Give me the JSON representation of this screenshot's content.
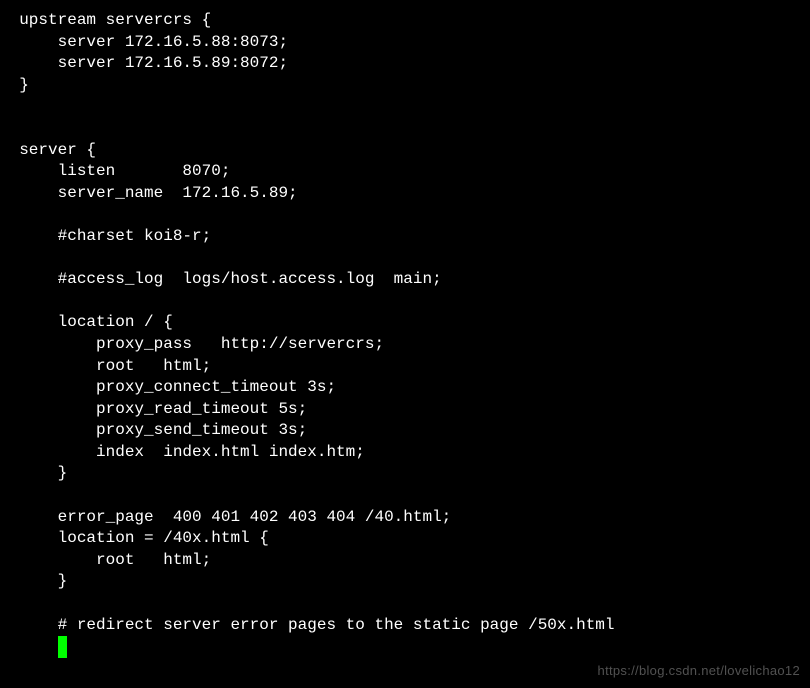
{
  "lines": [
    "  upstream servercrs {",
    "      server 172.16.5.88:8073;",
    "      server 172.16.5.89:8072;",
    "  }",
    "",
    "",
    "  server {",
    "      listen       8070;",
    "      server_name  172.16.5.89;",
    "",
    "      #charset koi8-r;",
    "",
    "      #access_log  logs/host.access.log  main;",
    "",
    "      location / {",
    "          proxy_pass   http://servercrs;",
    "          root   html;",
    "          proxy_connect_timeout 3s;",
    "          proxy_read_timeout 5s;",
    "          proxy_send_timeout 3s;",
    "          index  index.html index.htm;",
    "      }",
    "",
    "      error_page  400 401 402 403 404 /40.html;",
    "      location = /40x.html {",
    "          root   html;",
    "      }",
    "",
    "      # redirect server error pages to the static page /50x.html"
  ],
  "cursor_line_prefix": "      ",
  "cursor_char": "#",
  "watermark": "https://blog.csdn.net/lovelichao12"
}
